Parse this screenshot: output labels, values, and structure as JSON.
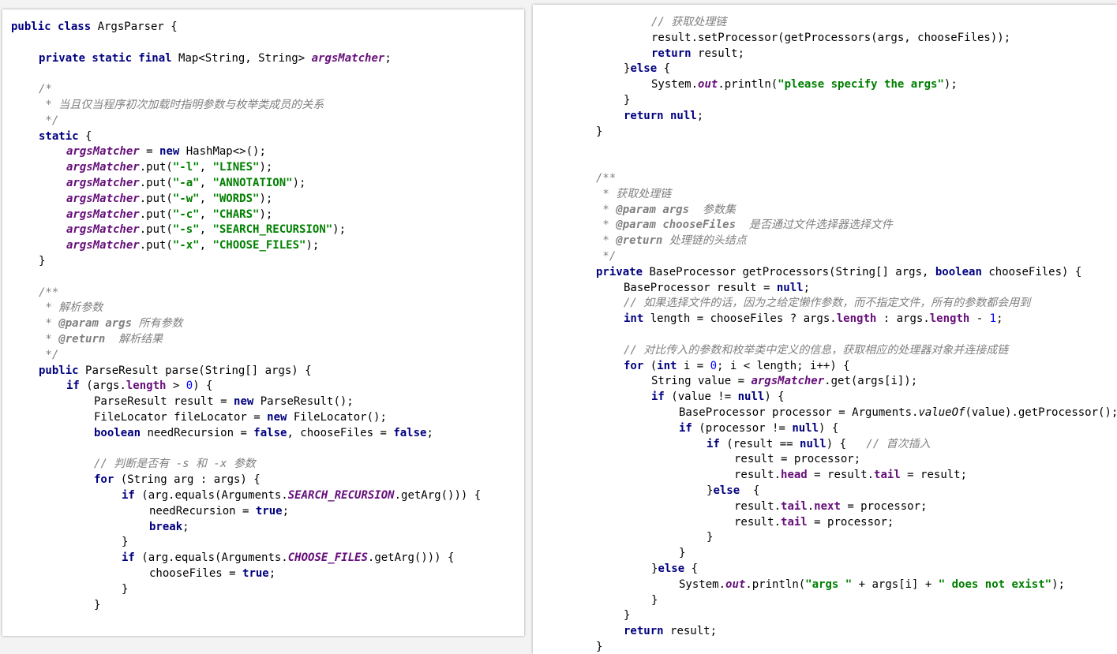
{
  "left_panel": {
    "lines": [
      {
        "indent": 0,
        "segs": [
          [
            "kw",
            "public class "
          ],
          [
            "",
            "ArgsParser {"
          ]
        ]
      },
      {
        "indent": 0,
        "segs": []
      },
      {
        "indent": 1,
        "segs": [
          [
            "kw",
            "private static final "
          ],
          [
            "",
            "Map<String, String> "
          ],
          [
            "fd",
            "argsMatcher"
          ],
          [
            "",
            ";"
          ]
        ]
      },
      {
        "indent": 0,
        "segs": []
      },
      {
        "indent": 1,
        "segs": [
          [
            "cm",
            "/*"
          ]
        ]
      },
      {
        "indent": 1,
        "segs": [
          [
            "cm",
            " * 当且仅当程序初次加载时指明参数与枚举类成员的关系"
          ]
        ]
      },
      {
        "indent": 1,
        "segs": [
          [
            "cm",
            " */"
          ]
        ]
      },
      {
        "indent": 1,
        "segs": [
          [
            "kw",
            "static "
          ],
          [
            "",
            "{"
          ]
        ]
      },
      {
        "indent": 2,
        "segs": [
          [
            "fd",
            "argsMatcher"
          ],
          [
            "",
            " = "
          ],
          [
            "kw",
            "new "
          ],
          [
            "",
            "HashMap<>();"
          ]
        ]
      },
      {
        "indent": 2,
        "segs": [
          [
            "fd",
            "argsMatcher"
          ],
          [
            "",
            ".put("
          ],
          [
            "st",
            "\"-l\""
          ],
          [
            "",
            ", "
          ],
          [
            "st",
            "\"LINES\""
          ],
          [
            "",
            ");"
          ]
        ]
      },
      {
        "indent": 2,
        "segs": [
          [
            "fd",
            "argsMatcher"
          ],
          [
            "",
            ".put("
          ],
          [
            "st",
            "\"-a\""
          ],
          [
            "",
            ", "
          ],
          [
            "st",
            "\"ANNOTATION\""
          ],
          [
            "",
            ");"
          ]
        ]
      },
      {
        "indent": 2,
        "segs": [
          [
            "fd",
            "argsMatcher"
          ],
          [
            "",
            ".put("
          ],
          [
            "st",
            "\"-w\""
          ],
          [
            "",
            ", "
          ],
          [
            "st",
            "\"WORDS\""
          ],
          [
            "",
            ");"
          ]
        ]
      },
      {
        "indent": 2,
        "segs": [
          [
            "fd",
            "argsMatcher"
          ],
          [
            "",
            ".put("
          ],
          [
            "st",
            "\"-c\""
          ],
          [
            "",
            ", "
          ],
          [
            "st",
            "\"CHARS\""
          ],
          [
            "",
            ");"
          ]
        ]
      },
      {
        "indent": 2,
        "segs": [
          [
            "fd",
            "argsMatcher"
          ],
          [
            "",
            ".put("
          ],
          [
            "st",
            "\"-s\""
          ],
          [
            "",
            ", "
          ],
          [
            "st",
            "\"SEARCH_RECURSION\""
          ],
          [
            "",
            ");"
          ]
        ]
      },
      {
        "indent": 2,
        "segs": [
          [
            "fd",
            "argsMatcher"
          ],
          [
            "",
            ".put("
          ],
          [
            "st",
            "\"-x\""
          ],
          [
            "",
            ", "
          ],
          [
            "st",
            "\"CHOOSE_FILES\""
          ],
          [
            "",
            ");"
          ]
        ]
      },
      {
        "indent": 1,
        "segs": [
          [
            "",
            "}"
          ]
        ]
      },
      {
        "indent": 0,
        "segs": []
      },
      {
        "indent": 1,
        "segs": [
          [
            "cm",
            "/**"
          ]
        ]
      },
      {
        "indent": 1,
        "segs": [
          [
            "cm",
            " * 解析参数"
          ]
        ]
      },
      {
        "indent": 1,
        "segs": [
          [
            "cm",
            " * "
          ],
          [
            "cm tag",
            "@param "
          ],
          [
            "cm tag",
            "args"
          ],
          [
            "cm",
            " 所有参数"
          ]
        ]
      },
      {
        "indent": 1,
        "segs": [
          [
            "cm",
            " * "
          ],
          [
            "cm tag",
            "@return"
          ],
          [
            "cm",
            "  解析结果"
          ]
        ]
      },
      {
        "indent": 1,
        "segs": [
          [
            "cm",
            " */"
          ]
        ]
      },
      {
        "indent": 1,
        "segs": [
          [
            "kw",
            "public "
          ],
          [
            "",
            "ParseResult parse(String[] args) {"
          ]
        ]
      },
      {
        "indent": 2,
        "segs": [
          [
            "kw",
            "if "
          ],
          [
            "",
            "(args."
          ],
          [
            "mb",
            "length"
          ],
          [
            "",
            " > "
          ],
          [
            "nm",
            "0"
          ],
          [
            "",
            ") {"
          ]
        ]
      },
      {
        "indent": 3,
        "segs": [
          [
            "",
            "ParseResult result = "
          ],
          [
            "kw",
            "new "
          ],
          [
            "",
            "ParseResult();"
          ]
        ]
      },
      {
        "indent": 3,
        "segs": [
          [
            "",
            "FileLocator fileLocator = "
          ],
          [
            "kw",
            "new "
          ],
          [
            "",
            "FileLocator();"
          ]
        ]
      },
      {
        "indent": 3,
        "segs": [
          [
            "kw",
            "boolean "
          ],
          [
            "",
            "needRecursion = "
          ],
          [
            "kw",
            "false"
          ],
          [
            "",
            ", chooseFiles = "
          ],
          [
            "kw",
            "false"
          ],
          [
            "",
            ";"
          ]
        ]
      },
      {
        "indent": 0,
        "segs": []
      },
      {
        "indent": 3,
        "segs": [
          [
            "cm",
            "// 判断是否有 -s 和 -x 参数"
          ]
        ]
      },
      {
        "indent": 3,
        "segs": [
          [
            "kw",
            "for "
          ],
          [
            "",
            "(String arg : args) {"
          ]
        ]
      },
      {
        "indent": 4,
        "segs": [
          [
            "kw",
            "if "
          ],
          [
            "",
            "(arg.equals(Arguments."
          ],
          [
            "fd",
            "SEARCH_RECURSION"
          ],
          [
            "",
            ".getArg())) {"
          ]
        ]
      },
      {
        "indent": 5,
        "segs": [
          [
            "",
            "needRecursion = "
          ],
          [
            "kw",
            "true"
          ],
          [
            "",
            ";"
          ]
        ]
      },
      {
        "indent": 5,
        "segs": [
          [
            "kw",
            "break"
          ],
          [
            "",
            ";"
          ]
        ]
      },
      {
        "indent": 4,
        "segs": [
          [
            "",
            "}"
          ]
        ]
      },
      {
        "indent": 4,
        "segs": [
          [
            "kw",
            "if "
          ],
          [
            "",
            "(arg.equals(Arguments."
          ],
          [
            "fd",
            "CHOOSE_FILES"
          ],
          [
            "",
            ".getArg())) {"
          ]
        ]
      },
      {
        "indent": 5,
        "segs": [
          [
            "",
            "chooseFiles = "
          ],
          [
            "kw",
            "true"
          ],
          [
            "",
            ";"
          ]
        ]
      },
      {
        "indent": 4,
        "segs": [
          [
            "",
            "}"
          ]
        ]
      },
      {
        "indent": 3,
        "segs": [
          [
            "",
            "}"
          ]
        ]
      }
    ]
  },
  "right_panel": {
    "lines": [
      {
        "indent": 3,
        "segs": [
          [
            "cm",
            "// 获取处理链"
          ]
        ]
      },
      {
        "indent": 3,
        "segs": [
          [
            "",
            "result.setProcessor(getProcessors(args, chooseFiles));"
          ]
        ]
      },
      {
        "indent": 3,
        "segs": [
          [
            "kw",
            "return "
          ],
          [
            "",
            "result;"
          ]
        ]
      },
      {
        "indent": 2,
        "segs": [
          [
            "",
            "}"
          ],
          [
            "kw",
            "else "
          ],
          [
            "",
            "{"
          ]
        ]
      },
      {
        "indent": 3,
        "segs": [
          [
            "",
            "System."
          ],
          [
            "fd",
            "out"
          ],
          [
            "",
            ".println("
          ],
          [
            "st",
            "\"please specify the args\""
          ],
          [
            "",
            ");"
          ]
        ]
      },
      {
        "indent": 2,
        "segs": [
          [
            "",
            "}"
          ]
        ]
      },
      {
        "indent": 2,
        "segs": [
          [
            "kw",
            "return null"
          ],
          [
            "",
            ";"
          ]
        ]
      },
      {
        "indent": 1,
        "segs": [
          [
            "",
            "}"
          ]
        ]
      },
      {
        "indent": 0,
        "segs": []
      },
      {
        "indent": 0,
        "segs": []
      },
      {
        "indent": 1,
        "segs": [
          [
            "cm",
            "/**"
          ]
        ]
      },
      {
        "indent": 1,
        "segs": [
          [
            "cm",
            " * 获取处理链"
          ]
        ]
      },
      {
        "indent": 1,
        "segs": [
          [
            "cm",
            " * "
          ],
          [
            "cm tag",
            "@param "
          ],
          [
            "cm tag",
            "args"
          ],
          [
            "cm",
            "  参数集"
          ]
        ]
      },
      {
        "indent": 1,
        "segs": [
          [
            "cm",
            " * "
          ],
          [
            "cm tag",
            "@param "
          ],
          [
            "cm tag",
            "chooseFiles"
          ],
          [
            "cm",
            "  是否通过文件选择器选择文件"
          ]
        ]
      },
      {
        "indent": 1,
        "segs": [
          [
            "cm",
            " * "
          ],
          [
            "cm tag",
            "@return"
          ],
          [
            "cm",
            " 处理链的头结点"
          ]
        ]
      },
      {
        "indent": 1,
        "segs": [
          [
            "cm",
            " */"
          ]
        ]
      },
      {
        "indent": 1,
        "segs": [
          [
            "kw",
            "private "
          ],
          [
            "",
            "BaseProcessor getProcessors(String[] args, "
          ],
          [
            "kw",
            "boolean "
          ],
          [
            "",
            "chooseFiles) {"
          ]
        ]
      },
      {
        "indent": 2,
        "segs": [
          [
            "",
            "BaseProcessor result = "
          ],
          [
            "kw",
            "null"
          ],
          [
            "",
            ";"
          ]
        ]
      },
      {
        "indent": 2,
        "segs": [
          [
            "cm",
            "// 如果选择文件的话，因为之给定懒作参数，而不指定文件，所有的参数都会用到"
          ]
        ]
      },
      {
        "indent": 2,
        "segs": [
          [
            "kw",
            "int "
          ],
          [
            "",
            "length = chooseFiles ? args."
          ],
          [
            "mb",
            "length"
          ],
          [
            "",
            " : args."
          ],
          [
            "mb",
            "length"
          ],
          [
            "",
            " - "
          ],
          [
            "nm",
            "1"
          ],
          [
            "",
            ";"
          ]
        ]
      },
      {
        "indent": 0,
        "segs": []
      },
      {
        "indent": 2,
        "segs": [
          [
            "cm",
            "// 对比传入的参数和枚举类中定义的信息，获取相应的处理器对象并连接成链"
          ]
        ]
      },
      {
        "indent": 2,
        "segs": [
          [
            "kw",
            "for "
          ],
          [
            "",
            "("
          ],
          [
            "kw",
            "int "
          ],
          [
            "",
            "i = "
          ],
          [
            "nm",
            "0"
          ],
          [
            "",
            "; i < length; i++) {"
          ]
        ]
      },
      {
        "indent": 3,
        "segs": [
          [
            "",
            "String value = "
          ],
          [
            "fd",
            "argsMatcher"
          ],
          [
            "",
            ".get(args[i]);"
          ]
        ]
      },
      {
        "indent": 3,
        "segs": [
          [
            "kw",
            "if "
          ],
          [
            "",
            "(value != "
          ],
          [
            "kw",
            "null"
          ],
          [
            "",
            ") {"
          ]
        ]
      },
      {
        "indent": 4,
        "segs": [
          [
            "",
            "BaseProcessor processor = Arguments."
          ],
          [
            "it",
            "valueOf"
          ],
          [
            "",
            "(value).getProcessor();"
          ]
        ]
      },
      {
        "indent": 4,
        "segs": [
          [
            "kw",
            "if "
          ],
          [
            "",
            "(processor != "
          ],
          [
            "kw",
            "null"
          ],
          [
            "",
            ") {"
          ]
        ]
      },
      {
        "indent": 5,
        "segs": [
          [
            "kw",
            "if "
          ],
          [
            "",
            "(result == "
          ],
          [
            "kw",
            "null"
          ],
          [
            "",
            ") {   "
          ],
          [
            "cm",
            "// 首次插入"
          ]
        ]
      },
      {
        "indent": 6,
        "segs": [
          [
            "",
            "result = processor;"
          ]
        ]
      },
      {
        "indent": 6,
        "segs": [
          [
            "",
            "result."
          ],
          [
            "mb",
            "head"
          ],
          [
            "",
            " = result."
          ],
          [
            "mb",
            "tail"
          ],
          [
            "",
            " = result;"
          ]
        ]
      },
      {
        "indent": 5,
        "segs": [
          [
            "",
            "}"
          ],
          [
            "kw",
            "else  "
          ],
          [
            "",
            "{"
          ]
        ]
      },
      {
        "indent": 6,
        "segs": [
          [
            "",
            "result."
          ],
          [
            "mb",
            "tail"
          ],
          [
            "",
            "."
          ],
          [
            "mb",
            "next"
          ],
          [
            "",
            " = processor;"
          ]
        ]
      },
      {
        "indent": 6,
        "segs": [
          [
            "",
            "result."
          ],
          [
            "mb",
            "tail"
          ],
          [
            "",
            " = processor;"
          ]
        ]
      },
      {
        "indent": 5,
        "segs": [
          [
            "",
            "}"
          ]
        ]
      },
      {
        "indent": 4,
        "segs": [
          [
            "",
            "}"
          ]
        ]
      },
      {
        "indent": 3,
        "segs": [
          [
            "",
            "}"
          ],
          [
            "kw",
            "else "
          ],
          [
            "",
            "{"
          ]
        ]
      },
      {
        "indent": 4,
        "segs": [
          [
            "",
            "System."
          ],
          [
            "fd",
            "out"
          ],
          [
            "",
            ".println("
          ],
          [
            "st",
            "\"args \""
          ],
          [
            "",
            " + args[i] + "
          ],
          [
            "st",
            "\" does not exist\""
          ],
          [
            "",
            ");"
          ]
        ]
      },
      {
        "indent": 3,
        "segs": [
          [
            "",
            "}"
          ]
        ]
      },
      {
        "indent": 2,
        "segs": [
          [
            "",
            "}"
          ]
        ]
      },
      {
        "indent": 2,
        "segs": [
          [
            "kw",
            "return "
          ],
          [
            "",
            "result;"
          ]
        ]
      },
      {
        "indent": 1,
        "segs": [
          [
            "",
            "}"
          ]
        ]
      }
    ]
  }
}
